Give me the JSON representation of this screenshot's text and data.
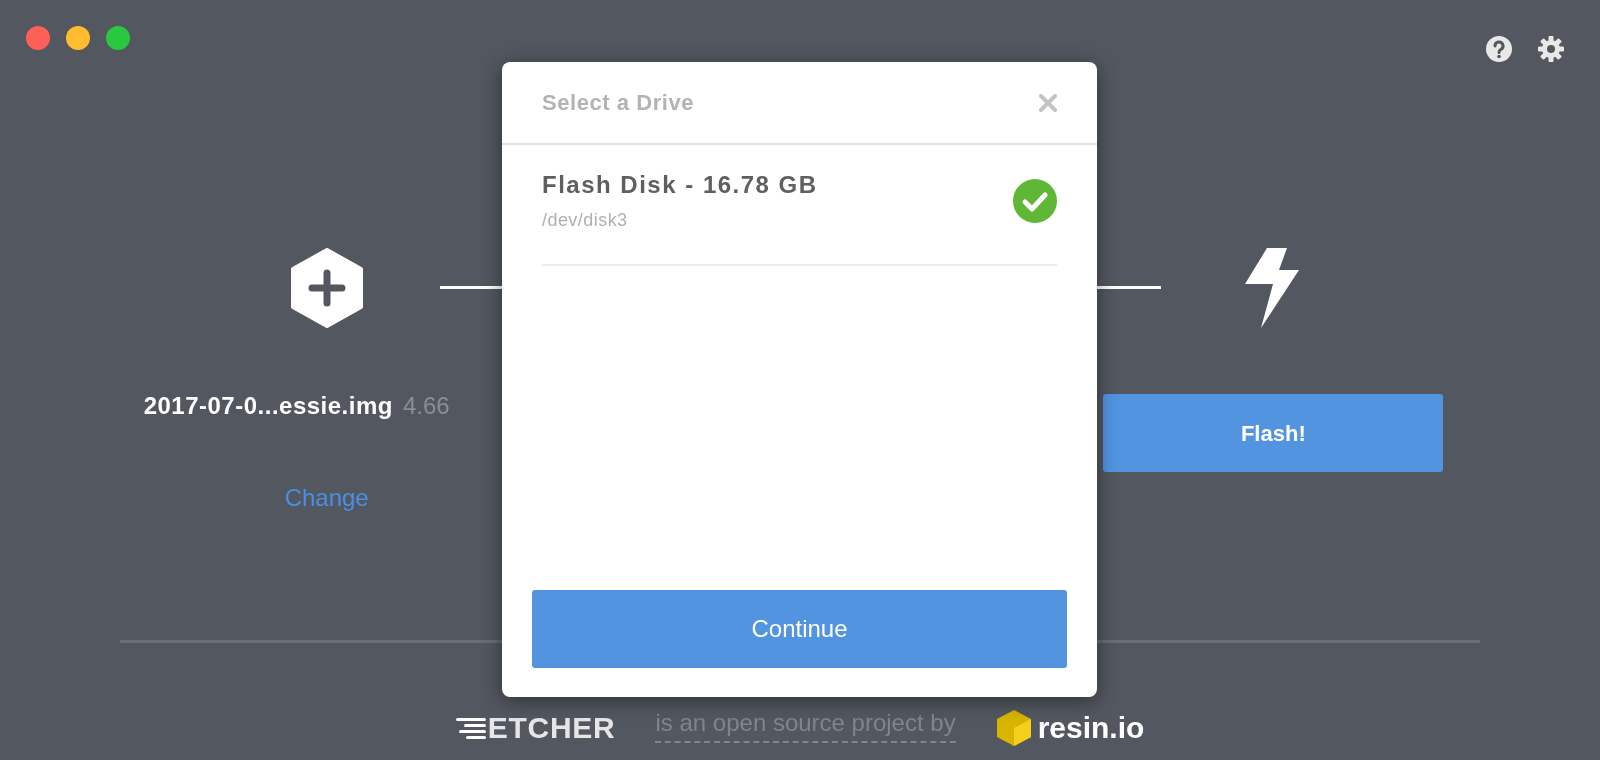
{
  "window": {
    "controls": [
      {
        "color": "#fe5f57"
      },
      {
        "color": "#febc2e"
      },
      {
        "color": "#28c840"
      }
    ]
  },
  "steps": [
    {
      "kind": "image",
      "filename": "2017-07-0...essie.img",
      "size": "4.66",
      "link": "Change"
    },
    {
      "kind": "flash",
      "button": "Flash!"
    }
  ],
  "dialog": {
    "title": "Select a Drive",
    "drives": [
      {
        "name": "Flash Disk - 16.78 GB",
        "path": "/dev/disk3",
        "selected": true
      }
    ],
    "button": "Continue"
  },
  "footer": {
    "logo": "ETCHER",
    "tagline": "is an open source project by",
    "company": "resin.io"
  }
}
